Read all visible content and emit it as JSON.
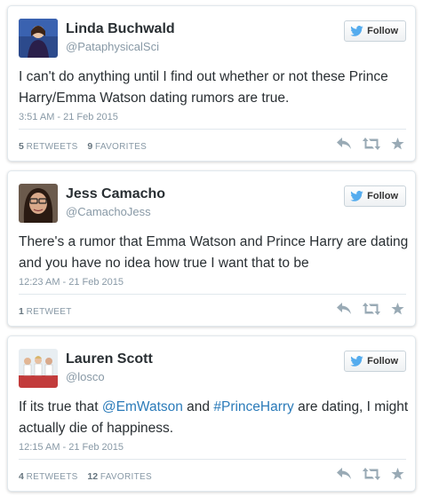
{
  "follow_label": "Follow",
  "tweets": [
    {
      "name": "Linda Buchwald",
      "handle": "@PataphysicalSci",
      "text": "I can't do anything until I find out whether or not these Prince Harry/Emma Watson dating rumors are true.",
      "time": "3:51 AM - 21 Feb 2015",
      "retweets": "5",
      "retweets_label": "RETWEETS",
      "favorites": "9",
      "favorites_label": "FAVORITES"
    },
    {
      "name": "Jess Camacho",
      "handle": "@CamachoJess",
      "text": "There's a rumor that Emma Watson and Prince Harry are dating and you have no idea how true I want that to be",
      "time": "12:23 AM - 21 Feb 2015",
      "retweets": "1",
      "retweets_label": "RETWEET"
    },
    {
      "name": "Lauren Scott",
      "handle": "@losco",
      "text_parts": {
        "a": "If its true that ",
        "mention": "@EmWatson",
        "b": " and ",
        "hashtag": "#PrinceHarry",
        "c": " are dating, I might actually die of happiness."
      },
      "time": "12:15 AM - 21 Feb 2015",
      "retweets": "4",
      "retweets_label": "RETWEETS",
      "favorites": "12",
      "favorites_label": "FAVORITES"
    }
  ],
  "colors": {
    "name": "#292f33",
    "handle": "#8899a6",
    "link": "#2b7bb9",
    "twitter_blue": "#55acee",
    "action_icon": "#99aab5"
  },
  "icons": [
    "twitter-bird-icon",
    "reply-icon",
    "retweet-icon",
    "favorite-star-icon"
  ]
}
